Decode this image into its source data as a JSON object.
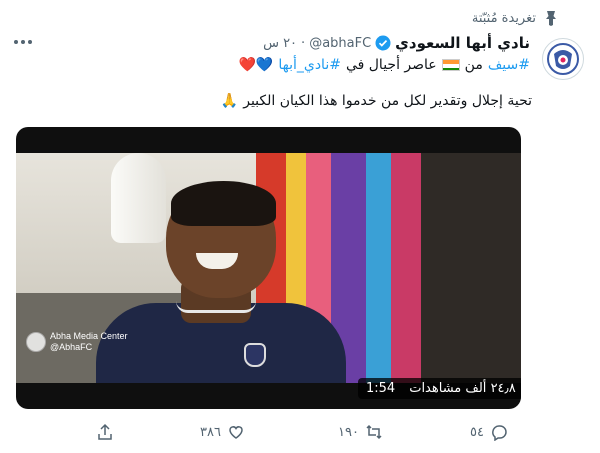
{
  "tweet": {
    "pinned_label": "تغريدة مُثبّتة",
    "display_name": "نادي أبها السعودي",
    "handle": "@abhaFC",
    "separator": "·",
    "time": "٢٠ س",
    "text_line1": {
      "hashtag1": "#سيف",
      "word1": "من",
      "word2": "عاصر أجيال في",
      "hashtag2": "#نادي_أبها",
      "hearts": "💙❤️"
    },
    "text_line2": {
      "text": "تحية إجلال وتقدير لكل من خدموا هذا الكيان الكبير",
      "emoji": "🙏"
    }
  },
  "video": {
    "duration": "1:54",
    "views": "٢٤٫٨ ألف مشاهدات",
    "watermark_title": "Abha Media Center",
    "watermark_handle": "@AbhaFC"
  },
  "actions": {
    "reply_count": "٥٤",
    "retweet_count": "١٩٠",
    "like_count": "٣٨٦"
  },
  "colors": {
    "accent": "#1d9bf0",
    "text": "#0f1419",
    "muted": "#536471"
  }
}
